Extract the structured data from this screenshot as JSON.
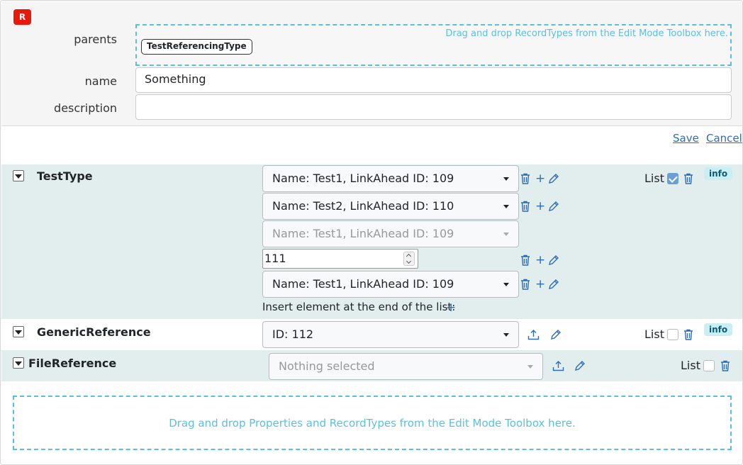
{
  "record_badge": "R",
  "form": {
    "parents_label": "parents",
    "parents_drop_hint": "Drag and drop RecordTypes from the Edit Mode Toolbox here.",
    "parent_chip": "TestReferencingType",
    "name_label": "name",
    "name_value": "Something",
    "description_label": "description",
    "description_value": ""
  },
  "actions": {
    "save": "Save",
    "cancel": "Cancel"
  },
  "properties": {
    "testtype": {
      "name": "TestType",
      "values": [
        "Name: Test1, LinkAhead ID: 109",
        "Name: Test2, LinkAhead ID: 110",
        "Name: Test1, LinkAhead ID: 109",
        "111",
        "Name: Test1, LinkAhead ID: 109"
      ],
      "list_label": "List",
      "list_checked": true,
      "info": "info",
      "insert_text": "Insert element at the end of the list:"
    },
    "generic": {
      "name": "GenericReference",
      "value": "ID: 112",
      "list_label": "List",
      "list_checked": false,
      "info": "info"
    },
    "file": {
      "name": "FileReference",
      "value": "Nothing selected",
      "list_label": "List",
      "list_checked": false
    }
  },
  "bottom_drop_hint": "Drag and drop Properties and RecordTypes from the Edit Mode Toolbox here.",
  "colors": {
    "accent": "#2d6db5",
    "dropzone": "#5bc0de",
    "row_bg": "#e2eeee",
    "badge": "#e8190b"
  }
}
